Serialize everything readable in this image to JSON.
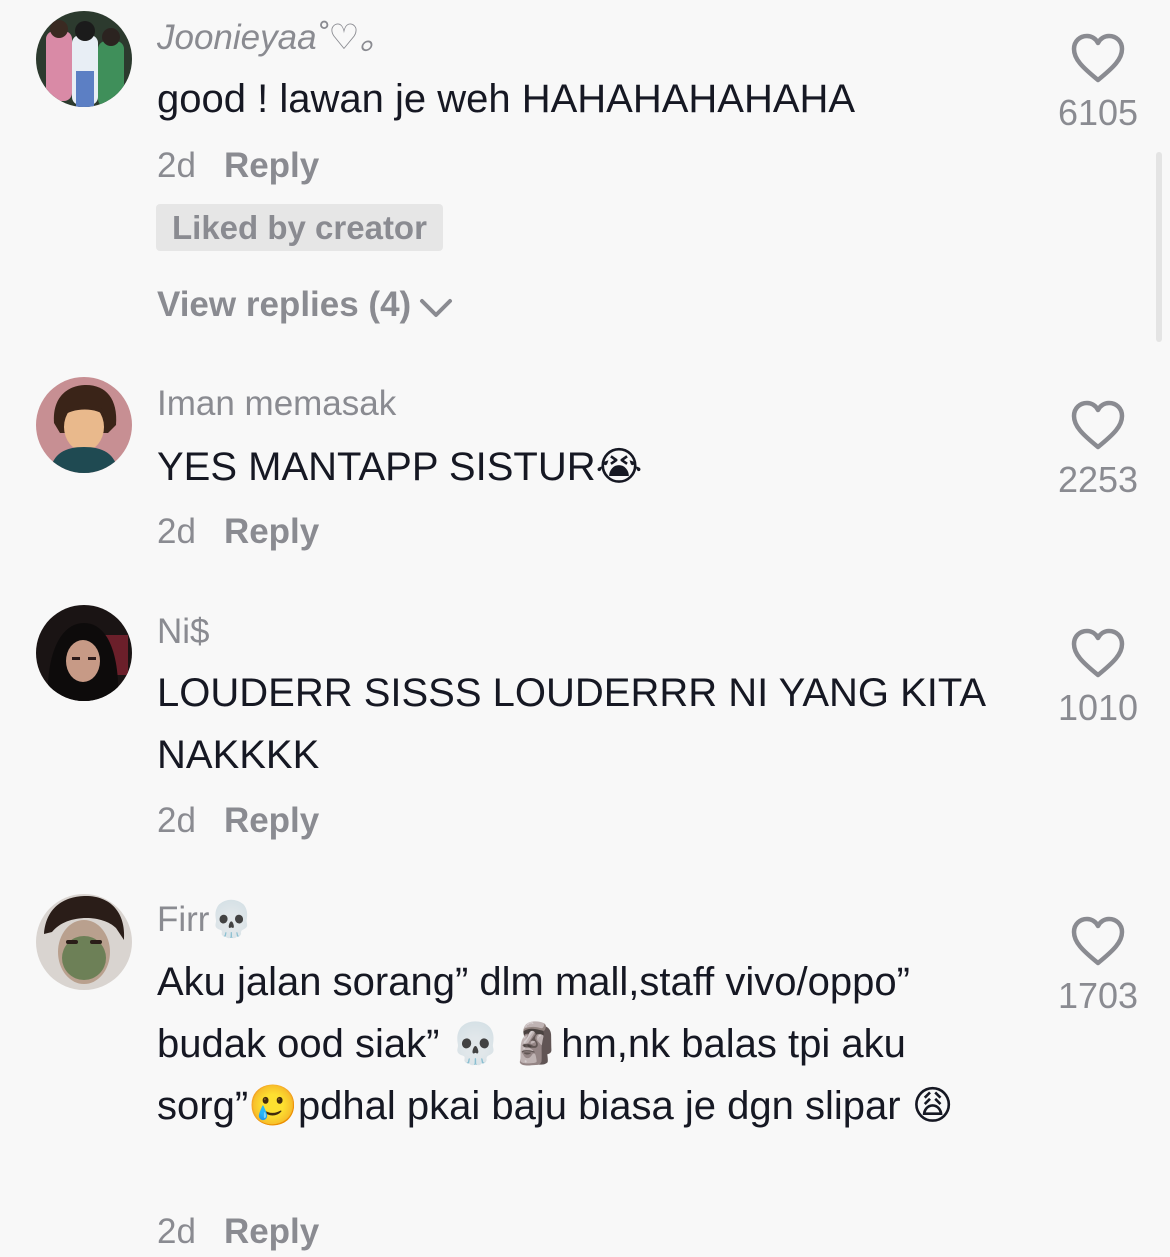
{
  "comments": [
    {
      "username": "Joonieyaa",
      "username_suffix": "˚♡｡",
      "text": "good ! lawan je weh HAHAHAHAHAHA",
      "time": "2d",
      "reply_label": "Reply",
      "badge": "Liked by creator",
      "view_replies": "View replies (4)",
      "likes": "6105"
    },
    {
      "username": "Iman memasak",
      "text": "YES MANTAPP SISTUR😭",
      "time": "2d",
      "reply_label": "Reply",
      "likes": "2253"
    },
    {
      "username": "Ni$",
      "text": "LOUDERR SISSS LOUDERRR NI YANG KITA NAKKKK",
      "time": "2d",
      "reply_label": "Reply",
      "likes": "1010"
    },
    {
      "username": "Firr💀",
      "text": "Aku jalan sorang” dlm mall,staff vivo/oppo” budak ood siak” 💀 🗿hm,nk balas tpi aku sorg”🥲pdhal pkai baju biasa je dgn slipar 😩",
      "time": "2d",
      "reply_label": "Reply",
      "likes": "1703"
    }
  ],
  "icons": {
    "like": "heart-outline-icon",
    "expand": "chevron-down-icon"
  },
  "colors": {
    "background": "#f8f8f8",
    "primary_text": "#161823",
    "secondary_text": "#8a8b91",
    "badge_bg": "#e6e6e6"
  }
}
